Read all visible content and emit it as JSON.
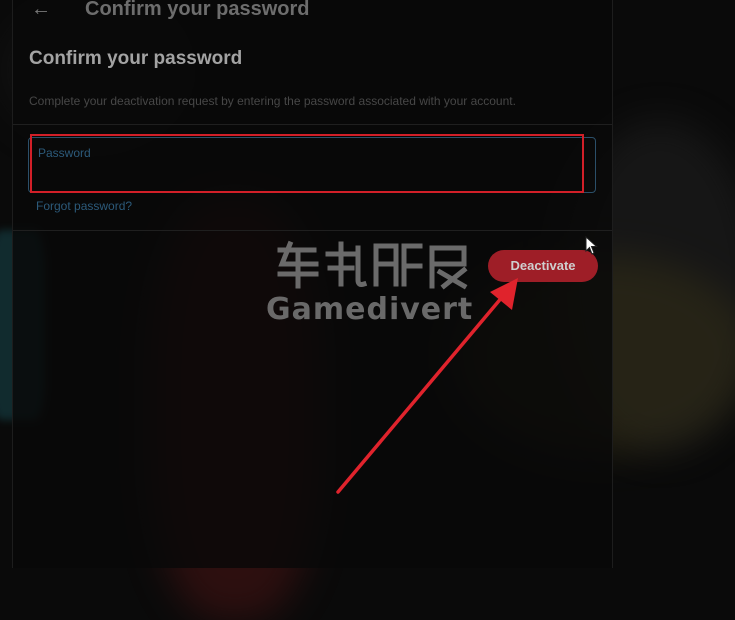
{
  "header": {
    "back_icon": "arrow-left-icon",
    "title": "Confirm your password"
  },
  "main": {
    "title": "Confirm your password",
    "description": "Complete your deactivation request by entering the password associated with your account.",
    "password_field": {
      "label": "Password",
      "value": ""
    },
    "forgot_password_link": "Forgot password?",
    "deactivate_button": "Deactivate"
  },
  "watermark": {
    "text": "Gamedivert"
  },
  "annotations": {
    "highlight_color": "#d21f28",
    "arrow_color": "#e0232c"
  },
  "colors": {
    "button_bg": "#9e1e27",
    "link": "#2c5a7a",
    "field_border": "#2b4f69"
  }
}
